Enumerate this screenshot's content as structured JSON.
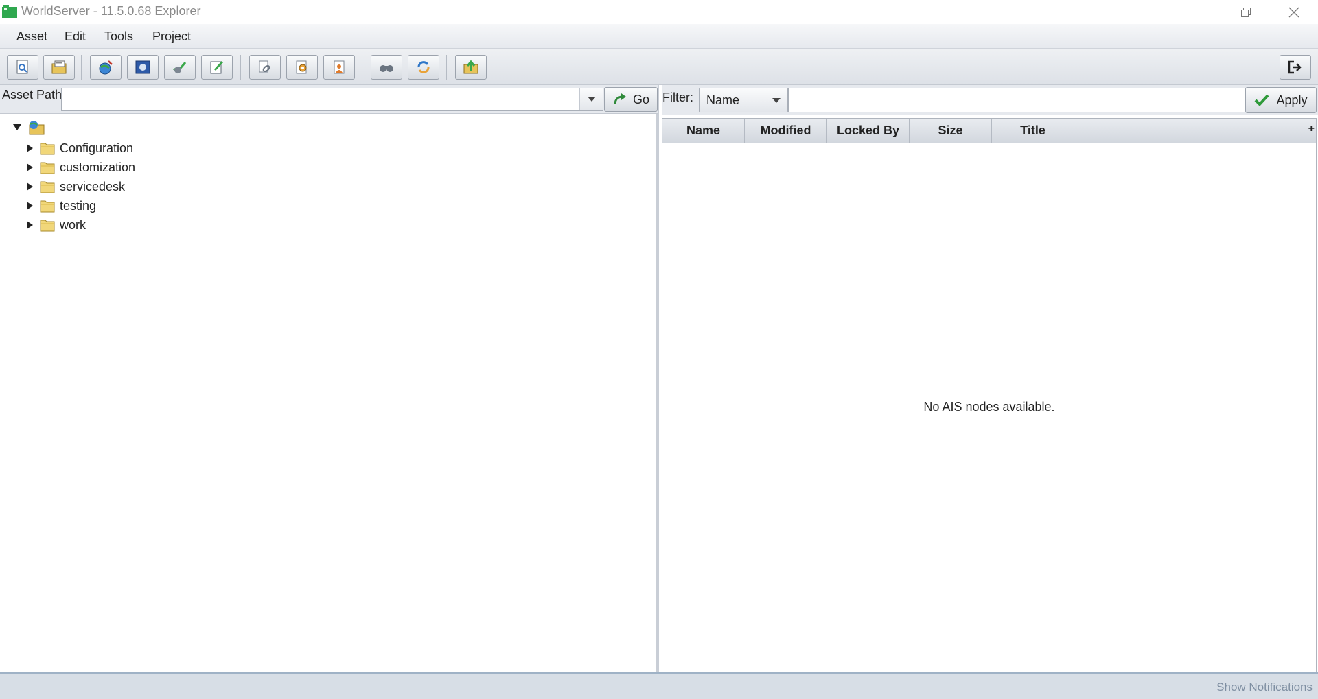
{
  "window": {
    "title": "WorldServer - 11.5.0.68 Explorer",
    "accent": "#3aa84a"
  },
  "menu": [
    {
      "label": "Asset"
    },
    {
      "label": "Edit"
    },
    {
      "label": "Tools"
    },
    {
      "label": "Project"
    }
  ],
  "toolbar": {
    "buttons": [
      {
        "icon": "document-preview-icon"
      },
      {
        "icon": "folder-properties-icon"
      },
      {
        "icon": "globe-target-icon"
      },
      {
        "icon": "image-frame-icon"
      },
      {
        "icon": "check-edit-icon"
      },
      {
        "icon": "pencil-note-icon"
      },
      {
        "icon": "link-chain-icon"
      },
      {
        "icon": "gear-document-icon"
      },
      {
        "icon": "user-document-icon"
      },
      {
        "icon": "binoculars-icon"
      },
      {
        "icon": "refresh-icon"
      },
      {
        "icon": "upload-folder-icon"
      }
    ],
    "logout_icon": "logout-icon"
  },
  "asset_path": {
    "label": "Asset Path:",
    "value": "",
    "go_label": "Go"
  },
  "tree": {
    "items": [
      {
        "label": "Configuration"
      },
      {
        "label": "customization"
      },
      {
        "label": "servicedesk"
      },
      {
        "label": "testing"
      },
      {
        "label": "work"
      }
    ]
  },
  "filter": {
    "label": "Filter:",
    "field": "Name",
    "value": "",
    "apply_label": "Apply"
  },
  "table": {
    "columns": [
      "Name",
      "Modified",
      "Locked By",
      "Size",
      "Title"
    ],
    "add_column": "+",
    "empty_message": "No AIS nodes available."
  },
  "status": {
    "notifications": "Show Notifications"
  }
}
